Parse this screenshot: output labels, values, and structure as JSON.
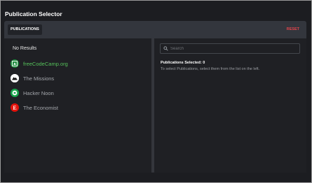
{
  "app": {
    "title": "Publication Selector"
  },
  "header": {
    "tab_label": "PUBLICATIONS",
    "reset_label": "RESET"
  },
  "left_panel": {
    "no_results": "No Results",
    "publications": [
      {
        "name": "freeCodeCamp.org",
        "icon": "freecodecamp-icon",
        "icon_bg": "#1f8d3f"
      },
      {
        "name": "The Missions",
        "icon": "mountain-icon",
        "icon_bg": "#ffffff"
      },
      {
        "name": "Hacker Noon",
        "icon": "hacker-noon-icon",
        "icon_bg": "#17a34a"
      },
      {
        "name": "The Economist",
        "icon": "economist-icon",
        "icon_bg": "#e3120b"
      }
    ]
  },
  "right_panel": {
    "search_placeholder": "Search",
    "selected_count": "Publications Selected: 0",
    "help_text": "To select Publications, select them from the list on the left."
  },
  "colors": {
    "background": "#1c1d21",
    "panel": "#1f2024",
    "header": "#33363d",
    "accent_reset": "#e4454c",
    "accent_green": "#55c05a"
  }
}
